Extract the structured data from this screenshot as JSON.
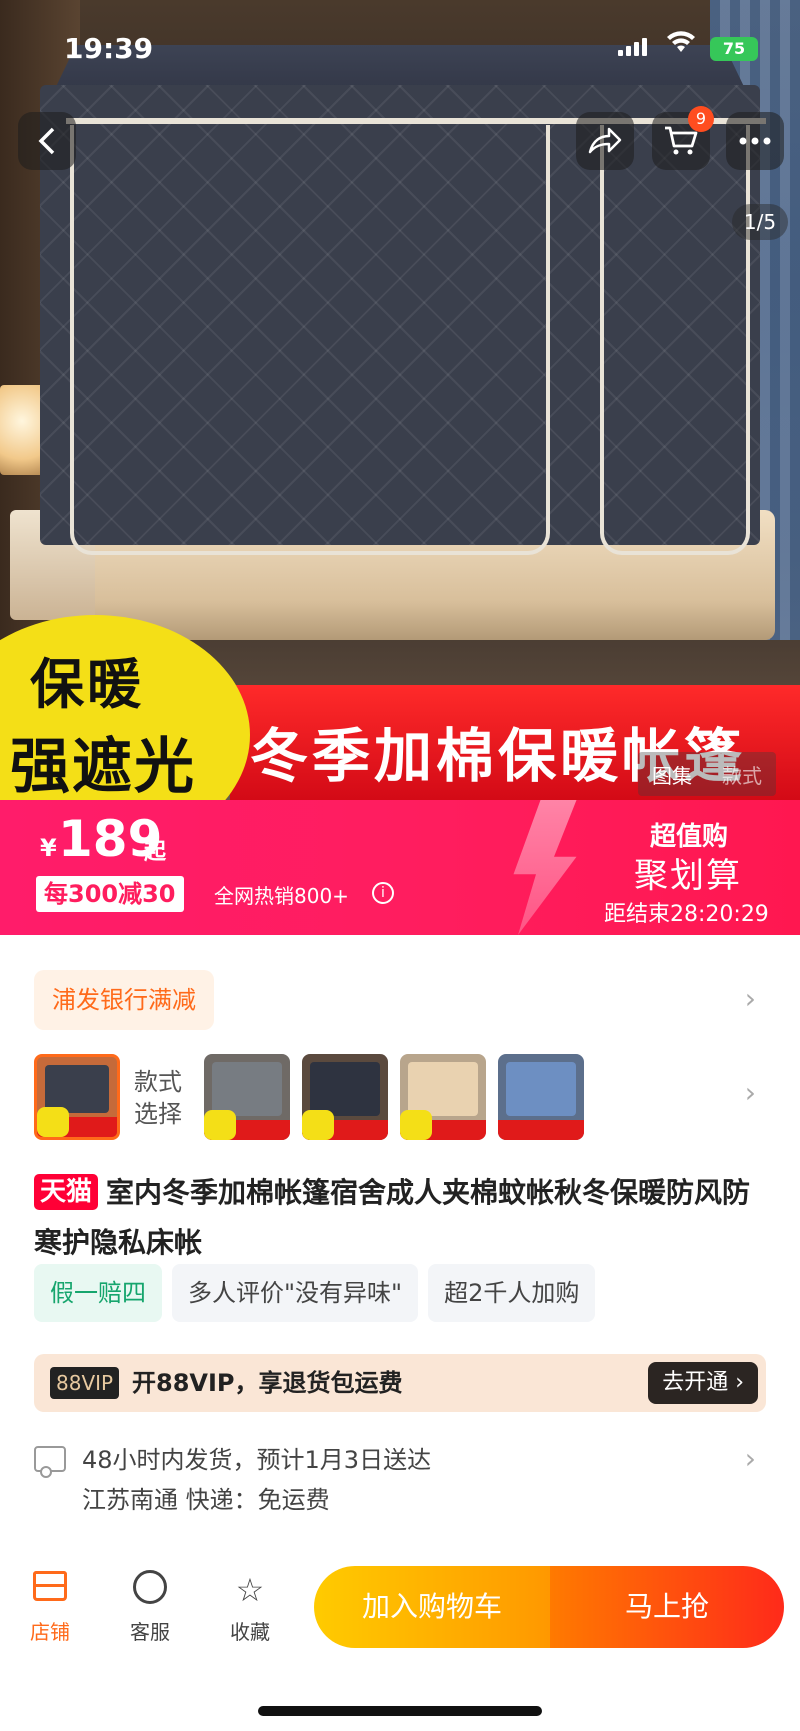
{
  "status_bar": {
    "time": "19:39",
    "battery": "75"
  },
  "nav": {
    "cart_count": "9",
    "page_indicator": "1/5"
  },
  "hero": {
    "badge_line1": "保暖",
    "badge_line2": "强遮光",
    "banner_text": "冬季加棉保暖帐篷",
    "tabs": [
      "图集",
      "款式"
    ]
  },
  "price": {
    "currency": "¥",
    "amount": "189",
    "suffix": "起",
    "coupon": "每300减30",
    "sales": "全网热销800+",
    "deal_line1": "超值购",
    "deal_line2": "聚划算",
    "deal_countdown": "距结束28:20:29"
  },
  "promo": {
    "label": "浦发银行满减"
  },
  "styles": {
    "label": "款式选择",
    "thumbs": [
      "dark-grey",
      "grey",
      "navy",
      "beige",
      "blue"
    ]
  },
  "product": {
    "store_tag": "天猫",
    "title": "室内冬季加棉帐篷宿舍成人夹棉蚊帐秋冬保暖防风防寒护隐私床帐",
    "tags": [
      "假一赔四",
      "多人评价\"没有异味\"",
      "超2千人加购"
    ]
  },
  "vip": {
    "badge": "88VIP",
    "text": "开88VIP，享退货包运费",
    "button": "去开通 ›"
  },
  "shipping": {
    "line1": "48小时内发货，预计1月3日送达",
    "line2": "江苏南通  快递：免运费"
  },
  "bottom_bar": {
    "shop": "店铺",
    "service": "客服",
    "favorite": "收藏",
    "add_to_cart": "加入购物车",
    "buy_now": "马上抢"
  },
  "colors": {
    "accent": "#ff6a1a",
    "price_band": "#ff1d5e",
    "tmall": "#ff0036"
  }
}
